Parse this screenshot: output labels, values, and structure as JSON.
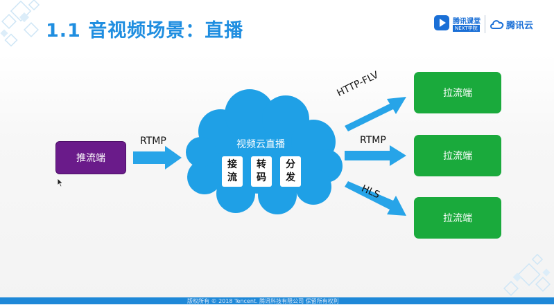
{
  "slide": {
    "title": "1.1 音视频场景：直播",
    "footer": "版权所有 © 2018 Tencent. 腾讯科技有限公司 保留所有权利"
  },
  "logos": {
    "keting_name": "腾讯课堂",
    "keting_sub": "NEXT学院",
    "cloud_name": "腾讯云"
  },
  "diagram": {
    "push_label": "推流端",
    "push_protocol": "RTMP",
    "cloud_label": "视频云直播",
    "stages": [
      "接流",
      "转码",
      "分发"
    ],
    "outputs": [
      {
        "protocol": "HTTP-FLV",
        "label": "拉流端"
      },
      {
        "protocol": "RTMP",
        "label": "拉流端"
      },
      {
        "protocol": "HLS",
        "label": "拉流端"
      }
    ]
  },
  "colors": {
    "title": "#1f8ee0",
    "push_box": "#6a1b8a",
    "pull_box": "#1aaa3c",
    "cloud": "#1fa0e6",
    "arrow": "#27a4e8"
  }
}
